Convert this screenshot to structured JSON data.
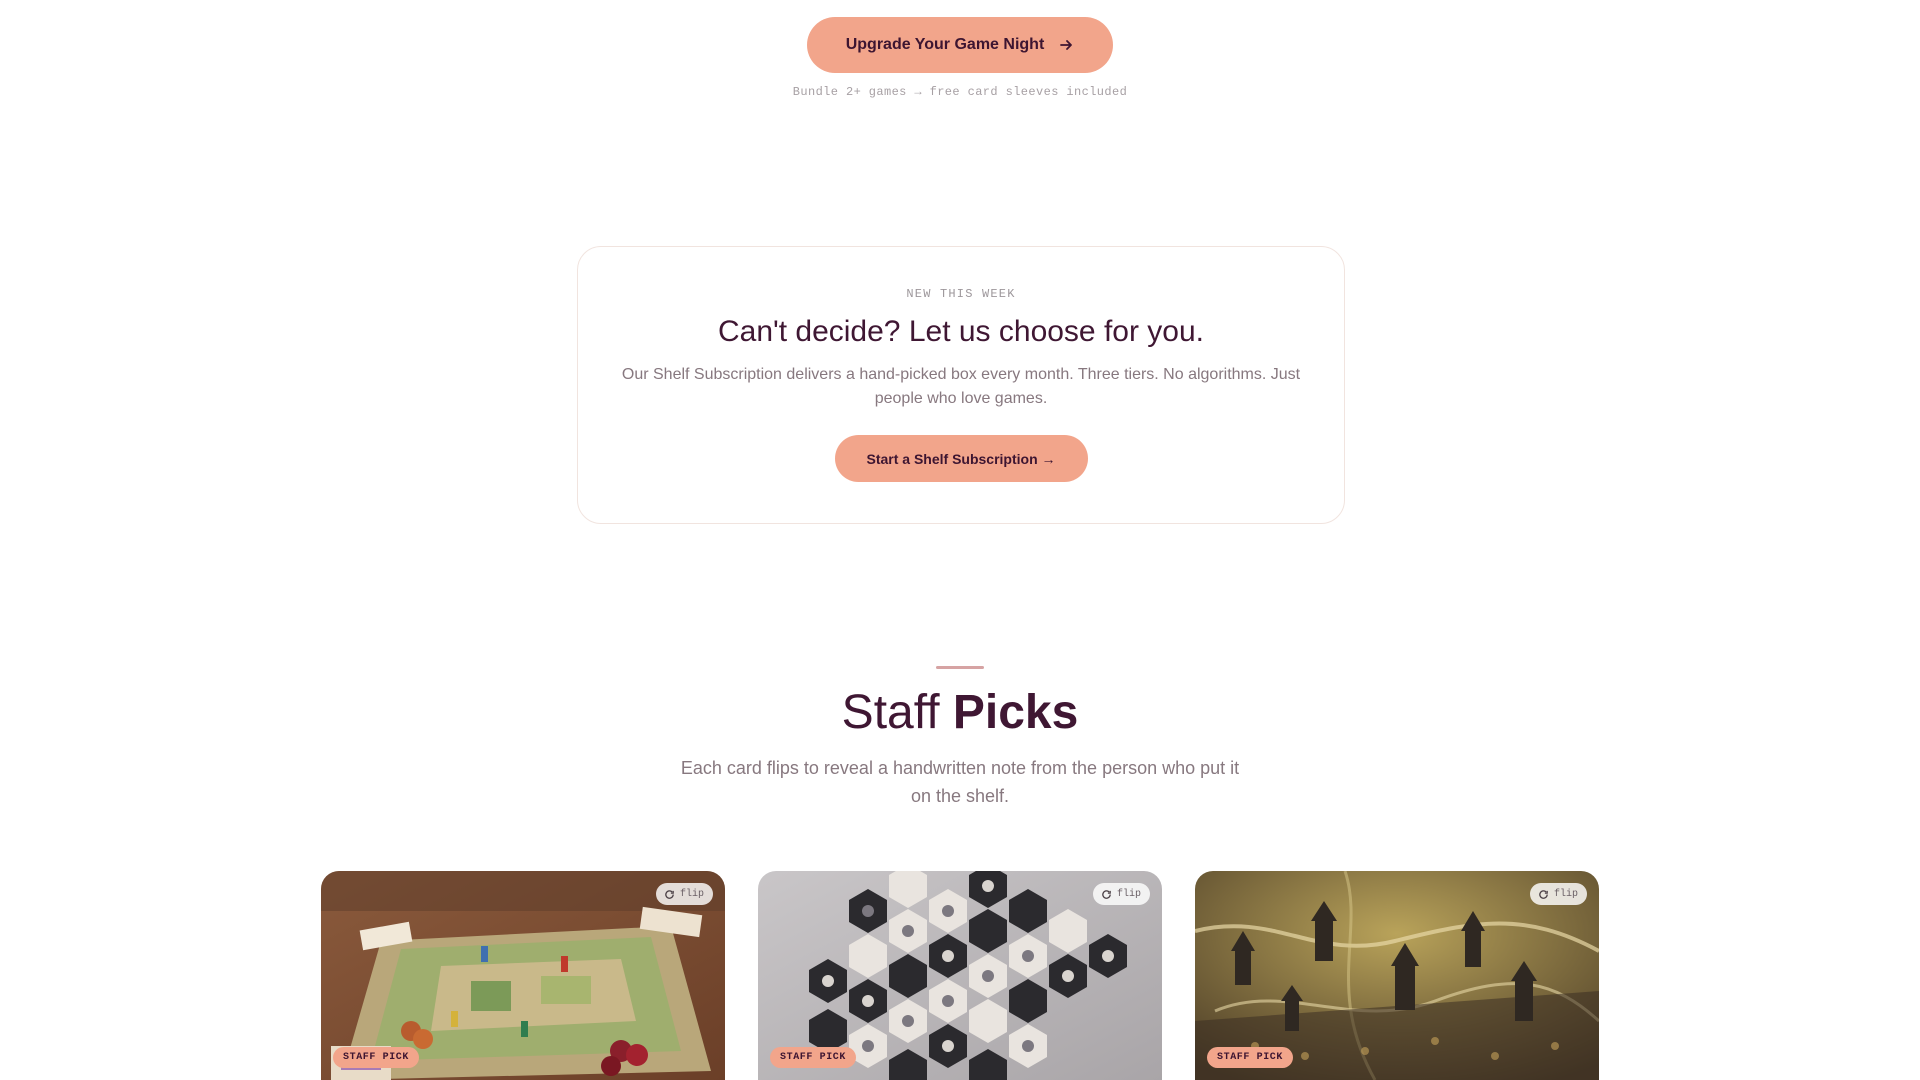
{
  "hero_cta": {
    "button_label": "Upgrade Your Game Night",
    "button_icon": "arrow-right-icon",
    "note": "Bundle 2+ games → free card sleeves included"
  },
  "subscription": {
    "eyebrow": "NEW THIS WEEK",
    "title": "Can't decide? Let us choose for you.",
    "description": "Our Shelf Subscription delivers a hand-picked box every month. Three tiers. No algorithms. Just people who love games.",
    "button_label": "Start a Shelf Subscription →"
  },
  "staff_picks": {
    "title_light": "Staff",
    "title_bold": "Picks",
    "description": "Each card flips to reveal a handwritten note from the person who put it on the shelf.",
    "cards": [
      {
        "image": "farm board game on wooden table",
        "flip_label": "flip",
        "badge": "STAFF PICK"
      },
      {
        "image": "black and white hexagon bug tiles",
        "flip_label": "flip",
        "badge": "STAFF PICK"
      },
      {
        "image": "fantasy map board with miniature towers",
        "flip_label": "flip",
        "badge": "STAFF PICK"
      }
    ]
  },
  "colors": {
    "accent": "#f2a58b",
    "heading": "#3f1733",
    "muted": "#87787f",
    "border": "#f1e4df"
  }
}
